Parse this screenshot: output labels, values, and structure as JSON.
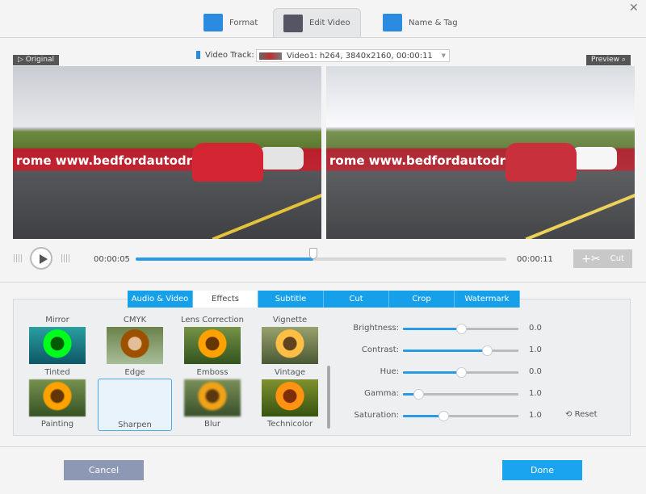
{
  "tabs": [
    {
      "label": "Format",
      "icon": "format-icon"
    },
    {
      "label": "Edit Video",
      "icon": "edit-video-icon",
      "active": true
    },
    {
      "label": "Name & Tag",
      "icon": "name-tag-icon"
    }
  ],
  "video_track": {
    "label": "Video Track:",
    "value": "Video1: h264, 3840x2160, 00:00:11"
  },
  "original_label": "Original",
  "preview_label": "Preview",
  "banner_text": "rome  www.bedfordautodrome.com",
  "player": {
    "current": "00:00:05",
    "total": "00:00:11",
    "progress": 0.48,
    "cut_label": "Cut"
  },
  "sub_tabs": [
    "Audio & Video",
    "Effects",
    "Subtitle",
    "Cut",
    "Crop",
    "Watermark"
  ],
  "active_sub_tab": "Effects",
  "effects": [
    "Mirror",
    "CMYK",
    "Lens Correction",
    "Vignette",
    "Tinted",
    "Edge",
    "Emboss",
    "Vintage",
    "Painting",
    "Sharpen",
    "Blur",
    "Technicolor"
  ],
  "selected_effect": "Sharpen",
  "adjust": [
    {
      "label": "Brightness:",
      "value": "0.0",
      "level": 0.5
    },
    {
      "label": "Contrast:",
      "value": "1.0",
      "level": 0.73
    },
    {
      "label": "Hue:",
      "value": "0.0",
      "level": 0.5
    },
    {
      "label": "Gamma:",
      "value": "1.0",
      "level": 0.13
    },
    {
      "label": "Saturation:",
      "value": "1.0",
      "level": 0.35
    }
  ],
  "reset_label": "Reset",
  "cancel_label": "Cancel",
  "done_label": "Done",
  "colors": {
    "accent": "#16a0ea",
    "cancel": "#8c98b4",
    "done": "#1aa3ee"
  }
}
